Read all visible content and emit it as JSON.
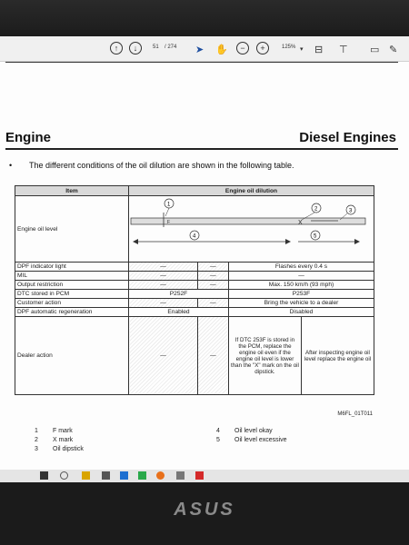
{
  "toolbar": {
    "page_current": "51",
    "page_total": "/ 274",
    "zoom": "125%",
    "icons": [
      "up-arrow-icon",
      "down-arrow-icon",
      "pointer-icon",
      "hand-icon",
      "zoom-out-icon",
      "zoom-in-icon",
      "fit-icon",
      "stamp-icon",
      "comment-icon",
      "pen-icon"
    ]
  },
  "document": {
    "title_left": "Engine",
    "title_right": "Diesel Engines",
    "bullet": "•",
    "intro": "The different conditions of the oil dilution are shown in the following table.",
    "table": {
      "header_item": "Item",
      "header_dilution": "Engine oil dilution",
      "rows": [
        {
          "item": "Engine oil level",
          "diagram": true
        },
        {
          "item": "DPF indicator light",
          "c1": "—",
          "c2": "—",
          "c3": "Flashes every 0.4 s"
        },
        {
          "item": "MIL",
          "c1": "—",
          "c2": "—",
          "c3": "—"
        },
        {
          "item": "Output restriction",
          "c1": "—",
          "c2": "—",
          "c3": "Max. 150 km/h (93 mph)"
        },
        {
          "item": "DTC stored in PCM",
          "c12": "P252F",
          "c3": "P253F"
        },
        {
          "item": "Customer action",
          "c1": "—",
          "c2": "—",
          "c3": "Bring the vehicle to a dealer"
        },
        {
          "item": "DPF automatic regeneration",
          "c12": "Enabled",
          "c3": "Disabled"
        },
        {
          "item": "Dealer action",
          "c1": "—",
          "c2": "—",
          "c3a": "If DTC 253F is stored in the PCM, replace the engine oil even if the engine oil level is lower than the \"X\" mark on the oil dipstick.",
          "c3b": "After inspecting engine oil level replace the engine oil"
        }
      ],
      "callouts": [
        "1",
        "2",
        "3",
        "4",
        "5"
      ]
    },
    "image_code": "M6FL_01T011",
    "legend": [
      {
        "num": "1",
        "text": "F mark"
      },
      {
        "num": "2",
        "text": "X mark"
      },
      {
        "num": "3",
        "text": "Oil dipstick"
      },
      {
        "num": "4",
        "text": "Oil level okay"
      },
      {
        "num": "5",
        "text": "Oil level excessive"
      }
    ]
  },
  "bezel": {
    "brand": "ASUS"
  },
  "colors": {
    "accent_blue": "#1e4fa0",
    "taskbar": "#e5e5e5",
    "pdf_red": "#d42a2a"
  }
}
